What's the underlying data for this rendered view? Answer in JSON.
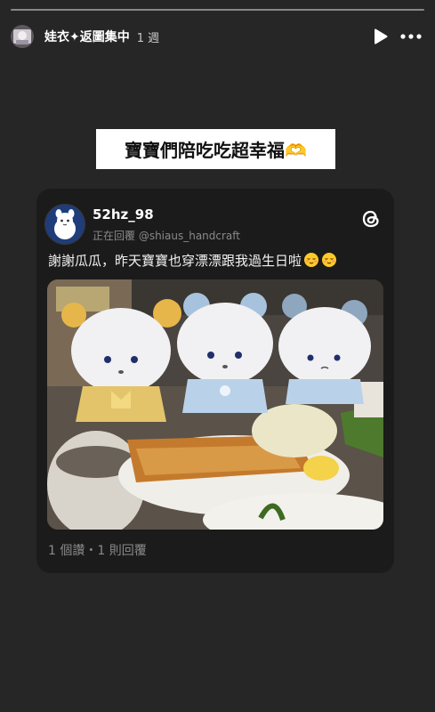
{
  "story": {
    "progress_segments": 1,
    "username": "娃衣✦返圖集中",
    "timestamp": "1 週",
    "icons": {
      "avatar": "profile-avatar",
      "play": "play-icon",
      "more": "more-options-icon"
    }
  },
  "caption": "寶寶們陪吃吃超幸福🫶",
  "post": {
    "author": "52hz_98",
    "reply_to": "正在回覆 @shiaus_handcraft",
    "text": "謝謝瓜瓜，昨天寶寶也穿漂漂跟我過生日啦",
    "emojis": [
      "relieved-face",
      "relieved-face"
    ],
    "image": "three-plush-bears-with-grilled-fish-meal",
    "stats": "1 個讚・1 則回覆",
    "icons": {
      "threads": "threads-logo-icon"
    }
  }
}
